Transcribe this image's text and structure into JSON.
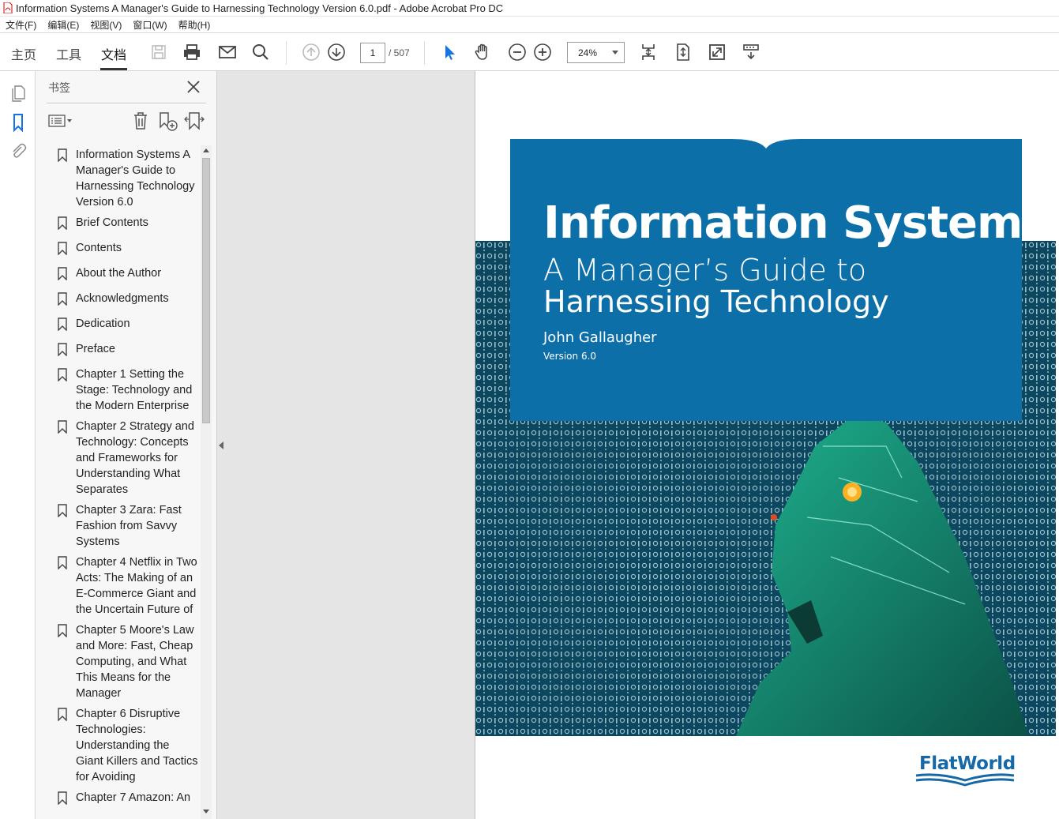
{
  "window": {
    "title": "Information Systems A Manager's Guide to Harnessing Technology Version 6.0.pdf - Adobe Acrobat Pro DC"
  },
  "menu": [
    "文件(F)",
    "编辑(E)",
    "视图(V)",
    "窗口(W)",
    "帮助(H)"
  ],
  "toolbar": {
    "tab_home": "主页",
    "tab_tools": "工具",
    "tab_document": "文档",
    "page_current": "1",
    "page_total": "/ 507",
    "zoom": "24%"
  },
  "bookmarks_panel": {
    "title": "书签",
    "items": [
      "Information Systems A Manager's Guide to Harnessing Technology Version 6.0",
      "Brief Contents",
      "Contents",
      "About the Author",
      "Acknowledgments",
      "Dedication",
      "Preface",
      "Chapter 1 Setting the Stage: Technology and the Modern Enterprise",
      "Chapter 2 Strategy and Technology: Concepts and Frameworks for Understanding What Separates",
      "Chapter 3 Zara: Fast Fashion from Savvy Systems",
      "Chapter 4 Netflix in Two Acts: The Making of an E-Commerce Giant and the Uncertain Future of",
      "Chapter 5 Moore's Law and More: Fast, Cheap Computing, and What This Means for the Manager",
      "Chapter 6 Disruptive Technologies: Understanding the Giant Killers and Tactics for Avoiding",
      "Chapter 7 Amazon: An"
    ]
  },
  "cover": {
    "title": "Information Systems",
    "subtitle_line1": "A Manager’s Guide to",
    "subtitle_line2": "Harnessing Technology",
    "author": "John Gallaugher",
    "version": "Version 6.0",
    "publisher": "FlatWorld"
  },
  "colors": {
    "cover_blue": "#0c6fa7",
    "publisher_blue": "#1668a7",
    "cursor_blue": "#1473e6"
  }
}
